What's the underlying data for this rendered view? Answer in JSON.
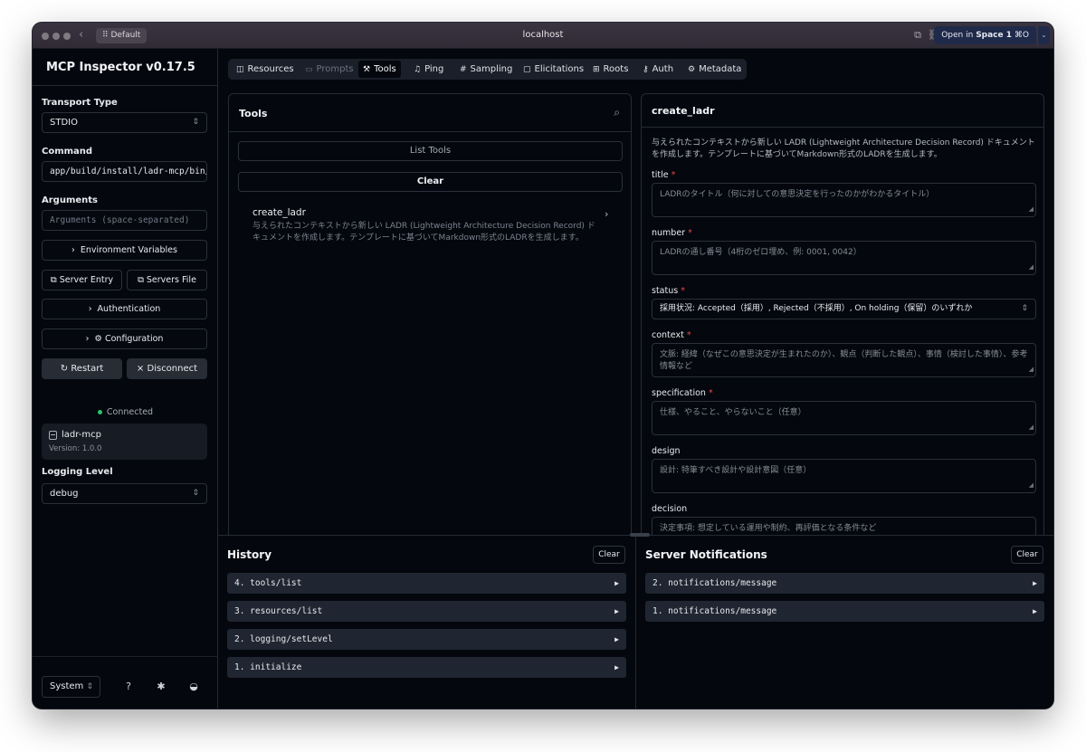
{
  "browser": {
    "profile": "Default",
    "url": "localhost",
    "open_in_prefix": "Open in",
    "open_in_space": "Space 1",
    "open_in_shortcut": "⌘O"
  },
  "sidebar": {
    "title": "MCP Inspector v0.17.5",
    "transport_label": "Transport Type",
    "transport_value": "STDIO",
    "command_label": "Command",
    "command_value": "app/build/install/ladr-mcp/bin/",
    "arguments_label": "Arguments",
    "arguments_placeholder": "Arguments (space-separated)",
    "env_vars": "Environment Variables",
    "server_entry": "Server Entry",
    "servers_file": "Servers File",
    "authentication": "Authentication",
    "configuration": "Configuration",
    "restart": "Restart",
    "disconnect": "Disconnect",
    "status": "Connected",
    "server_name": "ladr-mcp",
    "server_version": "Version: 1.0.0",
    "logging_label": "Logging Level",
    "logging_value": "debug",
    "theme_value": "System"
  },
  "tabs": [
    {
      "label": "Resources",
      "icon": "resources-icon"
    },
    {
      "label": "Prompts",
      "icon": "prompts-icon"
    },
    {
      "label": "Tools",
      "icon": "tools-icon"
    },
    {
      "label": "Ping",
      "icon": "bell-icon"
    },
    {
      "label": "Sampling",
      "icon": "hash-icon"
    },
    {
      "label": "Elicitations",
      "icon": "message-icon"
    },
    {
      "label": "Roots",
      "icon": "roots-icon"
    },
    {
      "label": "Auth",
      "icon": "key-icon"
    },
    {
      "label": "Metadata",
      "icon": "gear-icon"
    }
  ],
  "tools_panel": {
    "title": "Tools",
    "list_tools": "List Tools",
    "clear": "Clear",
    "tool_name": "create_ladr",
    "tool_desc": "与えられたコンテキストから新しい LADR (Lightweight Architecture Decision Record) ドキュメントを作成します。テンプレートに基づいてMarkdown形式のLADRを生成します。"
  },
  "form": {
    "title": "create_ladr",
    "description": "与えられたコンテキストから新しい LADR (Lightweight Architecture Decision Record) ドキュメントを作成します。テンプレートに基づいてMarkdown形式のLADRを生成します。",
    "fields": {
      "title": {
        "label": "title",
        "placeholder": "LADRのタイトル（何に対しての意思決定を行ったのかがわかるタイトル）"
      },
      "number": {
        "label": "number",
        "placeholder": "LADRの通し番号（4桁のゼロ埋め、例: 0001, 0042）"
      },
      "status": {
        "label": "status",
        "value": "採用状況: Accepted（採用）, Rejected（不採用）, On holding（保留）のいずれか"
      },
      "context": {
        "label": "context",
        "placeholder": "文脈: 経緯（なぜこの意思決定が生まれたのか）、観点（判断した観点）、事情（検討した事情）、参考情報など"
      },
      "specification": {
        "label": "specification",
        "placeholder": "仕様、やること、やらないこと（任意）"
      },
      "design": {
        "label": "design",
        "placeholder": "設計: 特筆すべき設計や設計意図（任意）"
      },
      "decision": {
        "label": "decision",
        "placeholder": "決定事項: 想定している運用や制約、再評価となる条件など"
      }
    },
    "required_mark": "*"
  },
  "history": {
    "title": "History",
    "clear": "Clear",
    "items": [
      "4. tools/list",
      "3. resources/list",
      "2. logging/setLevel",
      "1. initialize"
    ]
  },
  "notifications": {
    "title": "Server Notifications",
    "clear": "Clear",
    "items": [
      "2. notifications/message",
      "1. notifications/message"
    ]
  },
  "colors": {
    "background": "#04070d",
    "border": "#262b34",
    "connected": "#29c46a",
    "required": "#e24b4b"
  }
}
